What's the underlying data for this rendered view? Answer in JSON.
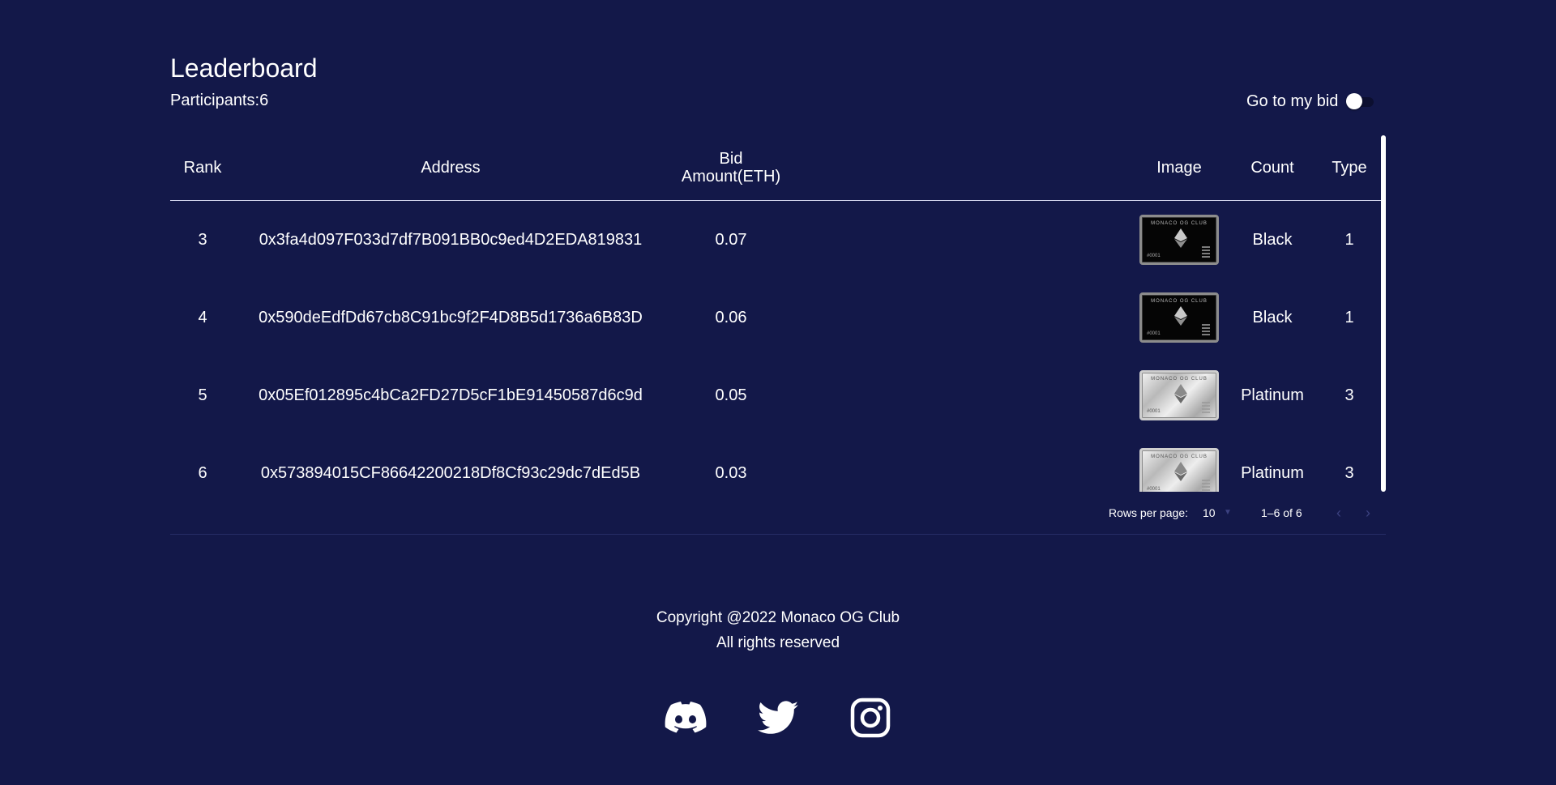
{
  "page": {
    "title": "Leaderboard",
    "participants_label": "Participants:",
    "participants_count": "6"
  },
  "toggle": {
    "label": "Go to my bid",
    "checked": false
  },
  "table": {
    "headers": {
      "rank": "Rank",
      "address": "Address",
      "bid_line1": "Bid",
      "bid_line2": "Amount(ETH)",
      "image": "Image",
      "count": "Count",
      "type": "Type"
    },
    "rows": [
      {
        "rank": "3",
        "address": "0x3fa4d097F033d7df7B091BB0c9ed4D2EDA819831",
        "bid": "0.07",
        "image": "Black card",
        "count": "Black",
        "type": "1"
      },
      {
        "rank": "4",
        "address": "0x590deEdfDd67cb8C91bc9f2F4D8B5d1736a6B83D",
        "bid": "0.06",
        "image": "Black card",
        "count": "Black",
        "type": "1"
      },
      {
        "rank": "5",
        "address": "0x05Ef012895c4bCa2FD27D5cF1bE91450587d6c9d",
        "bid": "0.05",
        "image": "Platinum card",
        "count": "Platinum",
        "type": "3"
      },
      {
        "rank": "6",
        "address": "0x573894015CF86642200218Df8Cf93c29dc7dEd5B",
        "bid": "0.03",
        "image": "Platinum card",
        "count": "Platinum",
        "type": "3"
      }
    ],
    "card_text": {
      "brand": "MONACO OG CLUB",
      "number": "#0001"
    }
  },
  "pagination": {
    "rows_per_page_label": "Rows per page:",
    "rows_per_page_value": "10",
    "range_label": "1–6 of 6",
    "prev_icon": "chevron-left-icon",
    "next_icon": "chevron-right-icon"
  },
  "footer": {
    "copyright": "Copyright @2022 Monaco OG Club",
    "rights": "All rights reserved",
    "socials": [
      "discord-icon",
      "twitter-icon",
      "instagram-icon"
    ]
  },
  "colors": {
    "background": "#131849",
    "text": "#ffffff",
    "muted": "#3b4180"
  }
}
